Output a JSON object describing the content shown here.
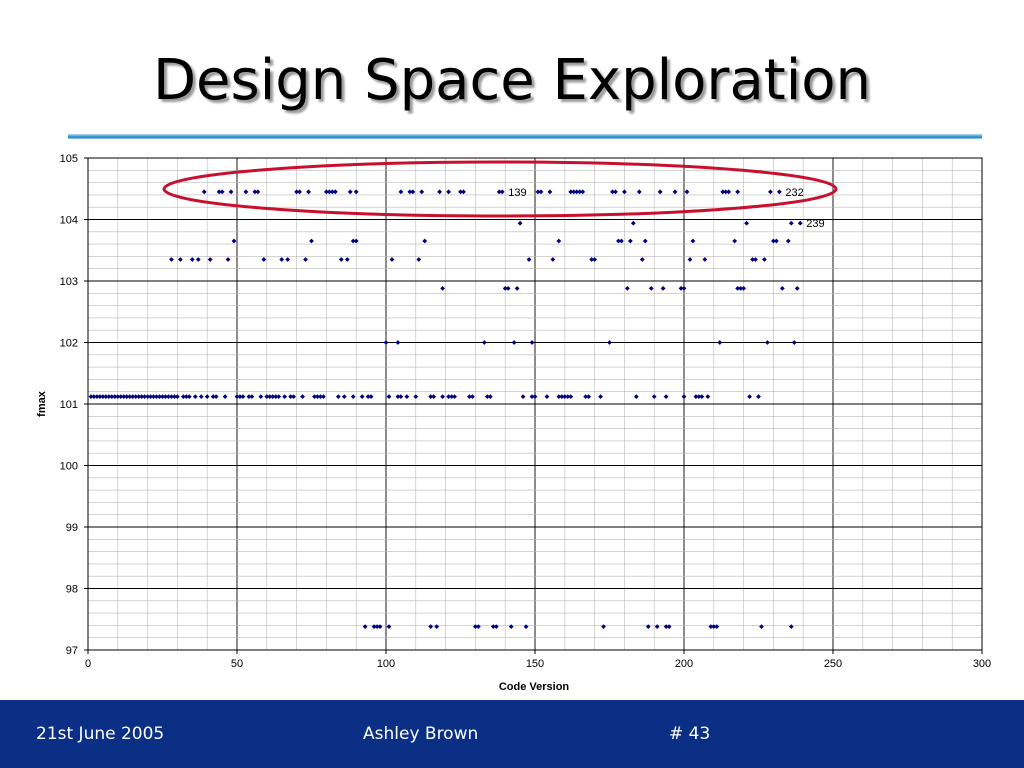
{
  "slide": {
    "title": "Design Space Exploration"
  },
  "footer": {
    "date": "21st June 2005",
    "author": "Ashley Brown",
    "slide_number": "# 43"
  },
  "colors": {
    "marker": "#000080",
    "ellipse": "#c8102e",
    "footer_bg": "#0a2f84",
    "title_rule": "#1b86c5"
  },
  "chart_data": {
    "type": "scatter",
    "xlabel": "Code Version",
    "ylabel": "fmax",
    "xlim": [
      0,
      300
    ],
    "ylim": [
      97,
      105
    ],
    "xticks": [
      0,
      50,
      100,
      150,
      200,
      250,
      300
    ],
    "yticks": [
      97,
      98,
      99,
      100,
      101,
      102,
      103,
      104,
      105
    ],
    "grid": true,
    "legend": "none",
    "series": [
      {
        "points": [
          [
            1,
            101.12
          ],
          [
            2,
            101.12
          ],
          [
            3,
            101.12
          ],
          [
            4,
            101.12
          ],
          [
            5,
            101.12
          ],
          [
            6,
            101.12
          ],
          [
            7,
            101.12
          ],
          [
            8,
            101.12
          ],
          [
            9,
            101.12
          ],
          [
            10,
            101.12
          ],
          [
            11,
            101.12
          ],
          [
            12,
            101.12
          ],
          [
            13,
            101.12
          ],
          [
            14,
            101.12
          ],
          [
            15,
            101.12
          ],
          [
            16,
            101.12
          ],
          [
            17,
            101.12
          ],
          [
            18,
            101.12
          ],
          [
            19,
            101.12
          ],
          [
            20,
            101.12
          ],
          [
            21,
            101.12
          ],
          [
            22,
            101.12
          ],
          [
            23,
            101.12
          ],
          [
            24,
            101.12
          ],
          [
            25,
            101.12
          ],
          [
            26,
            101.12
          ],
          [
            27,
            101.12
          ],
          [
            28,
            101.12
          ],
          [
            29,
            101.12
          ],
          [
            30,
            101.12
          ],
          [
            32,
            101.12
          ],
          [
            33,
            101.12
          ],
          [
            34,
            101.12
          ],
          [
            36,
            101.12
          ],
          [
            38,
            101.12
          ],
          [
            40,
            101.12
          ],
          [
            42,
            101.12
          ],
          [
            43,
            101.12
          ],
          [
            46,
            101.12
          ],
          [
            50,
            101.12
          ],
          [
            51,
            101.12
          ],
          [
            52,
            101.12
          ],
          [
            54,
            101.12
          ],
          [
            55,
            101.12
          ],
          [
            58,
            101.12
          ],
          [
            60,
            101.12
          ],
          [
            61,
            101.12
          ],
          [
            62,
            101.12
          ],
          [
            63,
            101.12
          ],
          [
            64,
            101.12
          ],
          [
            66,
            101.12
          ],
          [
            68,
            101.12
          ],
          [
            69,
            101.12
          ],
          [
            72,
            101.12
          ],
          [
            76,
            101.12
          ],
          [
            77,
            101.12
          ],
          [
            78,
            101.12
          ],
          [
            79,
            101.12
          ],
          [
            84,
            101.12
          ],
          [
            86,
            101.12
          ],
          [
            89,
            101.12
          ],
          [
            92,
            101.12
          ],
          [
            94,
            101.12
          ],
          [
            95,
            101.12
          ],
          [
            101,
            101.12
          ],
          [
            104,
            101.12
          ],
          [
            105,
            101.12
          ],
          [
            107,
            101.12
          ],
          [
            110,
            101.12
          ],
          [
            115,
            101.12
          ],
          [
            116,
            101.12
          ],
          [
            119,
            101.12
          ],
          [
            121,
            101.12
          ],
          [
            122,
            101.12
          ],
          [
            123,
            101.12
          ],
          [
            128,
            101.12
          ],
          [
            129,
            101.12
          ],
          [
            134,
            101.12
          ],
          [
            135,
            101.12
          ],
          [
            146,
            101.12
          ],
          [
            149,
            101.12
          ],
          [
            150,
            101.12
          ],
          [
            154,
            101.12
          ],
          [
            158,
            101.12
          ],
          [
            159,
            101.12
          ],
          [
            160,
            101.12
          ],
          [
            161,
            101.12
          ],
          [
            162,
            101.12
          ],
          [
            167,
            101.12
          ],
          [
            168,
            101.12
          ],
          [
            172,
            101.12
          ],
          [
            184,
            101.12
          ],
          [
            190,
            101.12
          ],
          [
            194,
            101.12
          ],
          [
            200,
            101.12
          ],
          [
            204,
            101.12
          ],
          [
            205,
            101.12
          ],
          [
            206,
            101.12
          ],
          [
            208,
            101.12
          ],
          [
            222,
            101.12
          ],
          [
            225,
            101.12
          ],
          [
            93,
            97.38
          ],
          [
            96,
            97.38
          ],
          [
            97,
            97.38
          ],
          [
            98,
            97.38
          ],
          [
            101,
            97.38
          ],
          [
            115,
            97.38
          ],
          [
            117,
            97.38
          ],
          [
            130,
            97.38
          ],
          [
            131,
            97.38
          ],
          [
            136,
            97.38
          ],
          [
            137,
            97.38
          ],
          [
            142,
            97.38
          ],
          [
            147,
            97.38
          ],
          [
            173,
            97.38
          ],
          [
            188,
            97.38
          ],
          [
            191,
            97.38
          ],
          [
            194,
            97.38
          ],
          [
            195,
            97.38
          ],
          [
            209,
            97.38
          ],
          [
            210,
            97.38
          ],
          [
            211,
            97.38
          ],
          [
            226,
            97.38
          ],
          [
            236,
            97.38
          ],
          [
            100,
            102.0
          ],
          [
            104,
            102.0
          ],
          [
            133,
            102.0
          ],
          [
            143,
            102.0
          ],
          [
            149,
            102.0
          ],
          [
            175,
            102.0
          ],
          [
            212,
            102.0
          ],
          [
            228,
            102.0
          ],
          [
            237,
            102.0
          ],
          [
            119,
            102.88
          ],
          [
            140,
            102.88
          ],
          [
            141,
            102.88
          ],
          [
            144,
            102.88
          ],
          [
            181,
            102.88
          ],
          [
            189,
            102.88
          ],
          [
            193,
            102.88
          ],
          [
            199,
            102.88
          ],
          [
            200,
            102.88
          ],
          [
            218,
            102.88
          ],
          [
            219,
            102.88
          ],
          [
            220,
            102.88
          ],
          [
            233,
            102.88
          ],
          [
            238,
            102.88
          ],
          [
            28,
            103.35
          ],
          [
            31,
            103.35
          ],
          [
            35,
            103.35
          ],
          [
            37,
            103.35
          ],
          [
            41,
            103.35
          ],
          [
            47,
            103.35
          ],
          [
            59,
            103.35
          ],
          [
            65,
            103.35
          ],
          [
            67,
            103.35
          ],
          [
            73,
            103.35
          ],
          [
            85,
            103.35
          ],
          [
            87,
            103.35
          ],
          [
            102,
            103.35
          ],
          [
            111,
            103.35
          ],
          [
            148,
            103.35
          ],
          [
            156,
            103.35
          ],
          [
            169,
            103.35
          ],
          [
            170,
            103.35
          ],
          [
            186,
            103.35
          ],
          [
            202,
            103.35
          ],
          [
            207,
            103.35
          ],
          [
            223,
            103.35
          ],
          [
            224,
            103.35
          ],
          [
            227,
            103.35
          ],
          [
            49,
            103.65
          ],
          [
            75,
            103.65
          ],
          [
            89,
            103.65
          ],
          [
            90,
            103.65
          ],
          [
            113,
            103.65
          ],
          [
            158,
            103.65
          ],
          [
            178,
            103.65
          ],
          [
            179,
            103.65
          ],
          [
            182,
            103.65
          ],
          [
            187,
            103.65
          ],
          [
            203,
            103.65
          ],
          [
            217,
            103.65
          ],
          [
            230,
            103.65
          ],
          [
            231,
            103.65
          ],
          [
            235,
            103.65
          ],
          [
            145,
            103.94
          ],
          [
            183,
            103.94
          ],
          [
            221,
            103.94
          ],
          [
            236,
            103.94
          ],
          [
            239,
            103.94
          ],
          [
            39,
            104.45
          ],
          [
            44,
            104.45
          ],
          [
            45,
            104.45
          ],
          [
            48,
            104.45
          ],
          [
            53,
            104.45
          ],
          [
            56,
            104.45
          ],
          [
            57,
            104.45
          ],
          [
            70,
            104.45
          ],
          [
            71,
            104.45
          ],
          [
            74,
            104.45
          ],
          [
            80,
            104.45
          ],
          [
            81,
            104.45
          ],
          [
            82,
            104.45
          ],
          [
            83,
            104.45
          ],
          [
            88,
            104.45
          ],
          [
            90,
            104.45
          ],
          [
            105,
            104.45
          ],
          [
            108,
            104.45
          ],
          [
            109,
            104.45
          ],
          [
            112,
            104.45
          ],
          [
            118,
            104.45
          ],
          [
            121,
            104.45
          ],
          [
            125,
            104.45
          ],
          [
            126,
            104.45
          ],
          [
            138,
            104.45
          ],
          [
            139,
            104.45
          ],
          [
            151,
            104.45
          ],
          [
            152,
            104.45
          ],
          [
            155,
            104.45
          ],
          [
            162,
            104.45
          ],
          [
            163,
            104.45
          ],
          [
            164,
            104.45
          ],
          [
            165,
            104.45
          ],
          [
            166,
            104.45
          ],
          [
            176,
            104.45
          ],
          [
            177,
            104.45
          ],
          [
            180,
            104.45
          ],
          [
            185,
            104.45
          ],
          [
            192,
            104.45
          ],
          [
            197,
            104.45
          ],
          [
            201,
            104.45
          ],
          [
            213,
            104.45
          ],
          [
            214,
            104.45
          ],
          [
            215,
            104.45
          ],
          [
            218,
            104.45
          ],
          [
            229,
            104.45
          ],
          [
            232,
            104.45
          ]
        ]
      }
    ],
    "annotations": [
      {
        "text": "139",
        "x": 139,
        "y": 104.45
      },
      {
        "text": "232",
        "x": 232,
        "y": 104.45
      },
      {
        "text": "239",
        "x": 239,
        "y": 103.94
      }
    ]
  }
}
